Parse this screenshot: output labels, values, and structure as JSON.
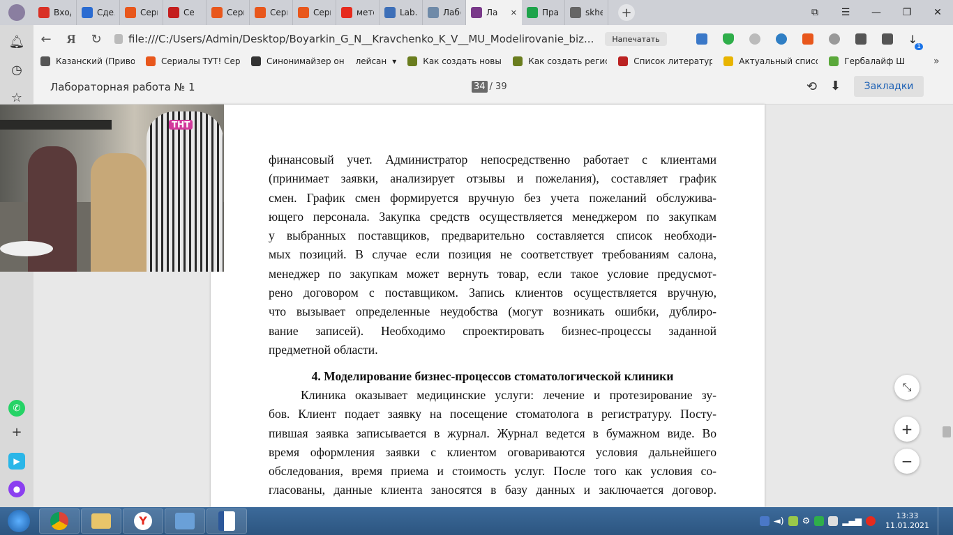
{
  "tabs": [
    {
      "label": "Входя",
      "icon": "gmail-icon",
      "color": "#d93025"
    },
    {
      "label": "Сдел",
      "icon": "24-icon",
      "color": "#2a6bd1"
    },
    {
      "label": "Сериа",
      "icon": "fox-icon",
      "color": "#e8571c"
    },
    {
      "label": "Се",
      "icon": "red-book-icon",
      "color": "#c41e1e"
    },
    {
      "label": "Сериа",
      "icon": "fox-icon",
      "color": "#e8571c"
    },
    {
      "label": "Сериа",
      "icon": "fox-icon",
      "color": "#e8571c"
    },
    {
      "label": "Сериа",
      "icon": "fox-icon",
      "color": "#e8571c"
    },
    {
      "label": "метод",
      "icon": "yandex-icon",
      "color": "#e62b1e"
    },
    {
      "label": "Lab.d",
      "icon": "document-icon",
      "color": "#3d6fb8"
    },
    {
      "label": "Лабо",
      "icon": "globe-icon",
      "color": "#6f8aa8"
    },
    {
      "label": "Ла",
      "icon": "pdf-icon",
      "color": "#7a3a8a",
      "active": true
    },
    {
      "label": "Прак",
      "icon": "check-icon",
      "color": "#1ea34b"
    },
    {
      "label": "skhem",
      "icon": "document-icon",
      "color": "#666666"
    }
  ],
  "address": {
    "url": "file:///C:/Users/Admin/Desktop/Boyarkin_G_N__Kravchenko_K_V__MU_Modelirovanie_biz...",
    "print_label": "Напечатать",
    "badge": "1"
  },
  "bookmarks": [
    {
      "label": "Казанский (Приво",
      "icon": "bank-icon"
    },
    {
      "label": "Сериалы ТУТ! Сер",
      "icon": "fox-icon"
    },
    {
      "label": "Синонимайзер он",
      "icon": "star-icon"
    },
    {
      "label": "лейсан",
      "icon": "folder-dropdown-icon"
    },
    {
      "label": "Как создать новый",
      "icon": "s-icon"
    },
    {
      "label": "Как создать регис",
      "icon": "s-icon"
    },
    {
      "label": "Список литератур",
      "icon": "book-icon"
    },
    {
      "label": "Актуальный списо",
      "icon": "c-icon"
    },
    {
      "label": "Гербалайф Ш",
      "icon": "herbal-icon"
    }
  ],
  "pdf": {
    "title": "Лабораторная работа № 1",
    "current_page": "34",
    "total_pages": "/ 39",
    "bookmarks_label": "Закладки"
  },
  "document": {
    "para1": [
      "финансовый учет. Администратор непосредственно работает с клиентами",
      "(принимает заявки, анализирует отзывы и пожелания), составляет график",
      "смен. График смен формируется вручную без учета пожеланий обслужива-",
      "ющего персонала. Закупка средств осуществляется менеджером по закупкам",
      "у выбранных поставщиков, предварительно составляется список необходи-",
      "мых позиций. В случае если позиция не соответствует требованиям салона,",
      "менеджер по закупкам может вернуть товар, если такое условие предусмот-",
      "рено договором с поставщиком. Запись клиентов осуществляется вручную,",
      "что вызывает определенные неудобства (могут возникать ошибки, дублиро-",
      "вание записей). Необходимо спроектировать бизнес-процессы заданной",
      "предметной области."
    ],
    "heading": "4. Моделирование бизнес-процессов стоматологической клиники",
    "para2": [
      "Клиника оказывает медицинские услуги: лечение и протезирование зу-",
      "бов. Клиент подает заявку на посещение стоматолога в регистратуру. Посту-",
      "пившая заявка записывается в журнал. Журнал ведется в бумажном виде. Во",
      "время оформления заявки с клиентом оговариваются условия дальнейшего",
      "обследования, время приема и стоимость услуг. После того как условия со-",
      "гласованы, данные клиента заносятся в базу данных и заключается договор."
    ]
  },
  "video": {
    "channel": "ТНТ"
  },
  "taskbar": {
    "time": "13:33",
    "date": "11.01.2021"
  }
}
